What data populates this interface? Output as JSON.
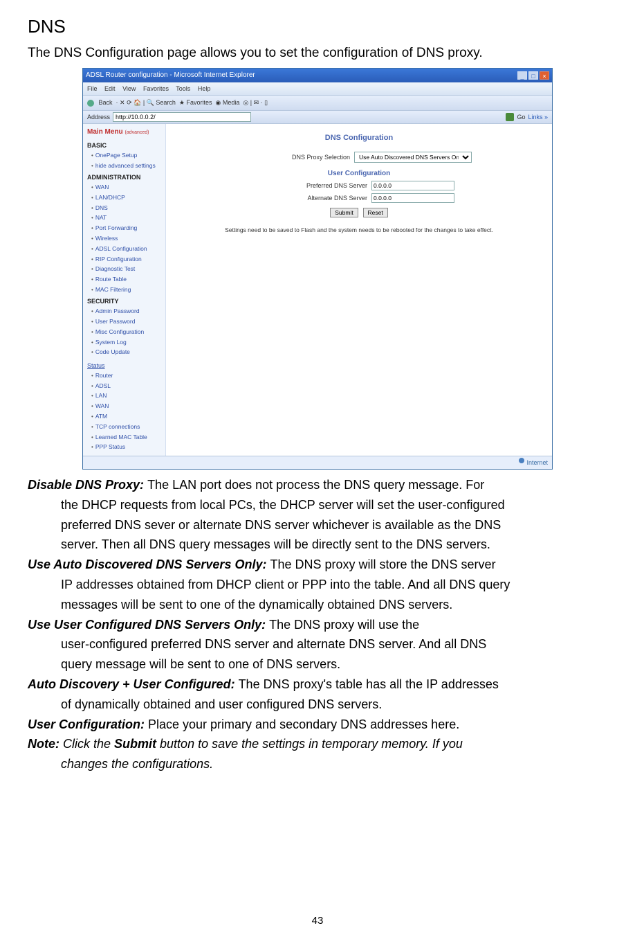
{
  "page": {
    "heading": "DNS",
    "intro": "The DNS Configuration page allows you to set the configuration of DNS proxy.",
    "number": "43"
  },
  "screenshot": {
    "title": "ADSL Router configuration - Microsoft Internet Explorer",
    "menubar": [
      "File",
      "Edit",
      "View",
      "Favorites",
      "Tools",
      "Help"
    ],
    "toolbar": {
      "back": "Back",
      "search": "Search",
      "favorites": "Favorites",
      "media": "Media"
    },
    "address": {
      "label": "Address",
      "value": "http://10.0.0.2/",
      "go": "Go",
      "links": "Links »"
    },
    "sidebar": {
      "main_menu": "Main Menu",
      "main_menu_sub": "(advanced)",
      "basic": {
        "header": "BASIC",
        "items": [
          "OnePage Setup",
          "hide advanced settings"
        ]
      },
      "admin": {
        "header": "ADMINISTRATION",
        "items": [
          "WAN",
          "LAN/DHCP",
          "DNS",
          "NAT",
          "Port Forwarding",
          "Wireless",
          "ADSL Configuration",
          "RIP Configuration",
          "Diagnostic Test",
          "Route Table",
          "MAC Filtering"
        ]
      },
      "security": {
        "header": "SECURITY",
        "items": [
          "Admin Password",
          "User Password",
          "Misc Configuration",
          "System Log",
          "Code Update"
        ]
      },
      "status": {
        "header": "Status",
        "items": [
          "Router",
          "ADSL",
          "LAN",
          "WAN",
          "ATM",
          "TCP connections",
          "Learned MAC Table",
          "PPP Status"
        ]
      }
    },
    "main": {
      "title": "DNS Configuration",
      "proxy_label": "DNS Proxy Selection",
      "proxy_value": "Use Auto Discovered DNS Servers Only",
      "user_conf": "User Configuration",
      "preferred_label": "Preferred DNS Server",
      "preferred_value": "0.0.0.0",
      "alternate_label": "Alternate DNS Server",
      "alternate_value": "0.0.0.0",
      "submit": "Submit",
      "reset": "Reset",
      "save_note": "Settings need to be saved to Flash and the system needs to be rebooted for the changes to take effect."
    },
    "statusbar": "Internet"
  },
  "defs": {
    "disable": {
      "term": "Disable DNS Proxy: ",
      "first": "The LAN port does not process the DNS query message. For",
      "cont1": "the DHCP requests from local PCs, the DHCP server will set the user-configured",
      "cont2": "preferred DNS sever or alternate DNS server whichever is available as the DNS",
      "cont3": "server. Then all DNS query messages will be directly sent to the DNS servers."
    },
    "auto": {
      "term": "Use Auto Discovered DNS Servers Only: ",
      "first": "The DNS proxy will store the DNS server",
      "cont1": "IP addresses obtained from DHCP client or PPP into the table. And all DNS query",
      "cont2": "messages will be sent to one of the dynamically obtained DNS servers."
    },
    "user": {
      "term": "Use User Configured DNS Servers Only: ",
      "first": "The DNS proxy will use the",
      "cont1": "user-configured preferred DNS server and alternate DNS server. And all DNS",
      "cont2": "query message will be sent to one of DNS servers."
    },
    "both": {
      "term": "Auto Discovery + User Configured: ",
      "first": "The DNS proxy's table has all the IP addresses",
      "cont1": "of dynamically obtained and user configured DNS servers."
    },
    "uc": {
      "term": "User Configuration: ",
      "first": "Place your primary and secondary DNS addresses here."
    },
    "note": {
      "label": "Note: ",
      "pre": "Click the ",
      "bold": "Submit",
      "post": " button to save the settings in temporary memory. If you",
      "cont": "changes the configurations."
    }
  }
}
